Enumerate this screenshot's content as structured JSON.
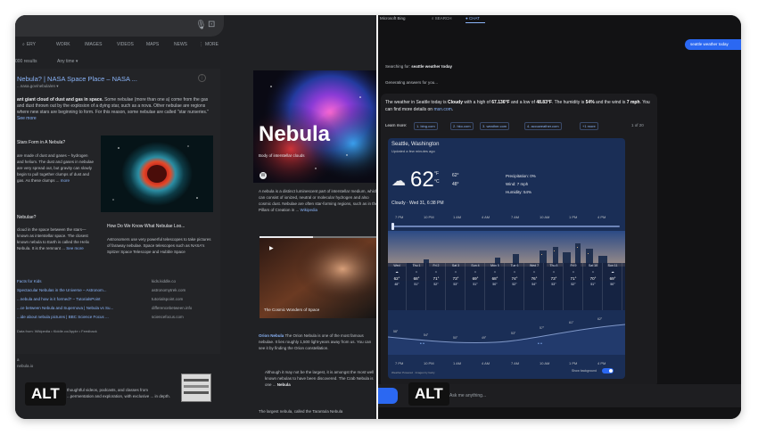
{
  "left": {
    "search": {
      "mic_icon": "microphone-icon",
      "camera_icon": "camera-icon"
    },
    "tabs": [
      "ERY",
      "WORK",
      "IMAGES",
      "VIDEOS",
      "MAPS",
      "NEWS",
      "MORE"
    ],
    "results_count": "000 results",
    "any_time": "Any time ▾",
    "result": {
      "title": "Nebula? | NASA Space Place – NASA ...",
      "url": "...nasa.gov/nebula/en ▾",
      "snippet_bold": "ant giant cloud of dust and gas in space.",
      "snippet": " Some nebulae (more than one a) come from the gas and dust thrown out by the explosion of a dying star, such as a nova. Other nebulae are regions where new stars are beginning to form. For this reason, some nebulae are called \"star nurseries.\"",
      "see_more": "See more"
    },
    "q1": "Stars Form in A Nebula?",
    "q1_text": "are made of dust and gases – hydrogen and helium. The dust and gases in nebulae are very spread out, but gravity can slowly begin to pull together clumps of dust and gas. As these clumps ...",
    "q1_more": "more",
    "q2": "Nebulae?",
    "q2_text": "cloud in the space between the stars—known as interstellar space. The closest known nebula to Earth is called the Helix Nebula. It is the remnant ...",
    "q2_more": "See more",
    "helix_question": "How Do We Know What Nebulae Loo...",
    "helix_text": "Astronomers use very powerful telescopes to take pictures of faraway nebulae. Space telescopes such as NASA's Spitzer Space Telescope and Hubble Space",
    "links": [
      {
        "title": "Facts for Kids",
        "domain": "kids.kiddle.co"
      },
      {
        "title": "Spectacular Nebulas in the Universe – Astronom...",
        "domain": "astronomytrek.com"
      },
      {
        "title": "...nebula and how is it formed? – TutorialsPoint",
        "domain": "tutorialspoint.com"
      },
      {
        "title": "...ce between Nebula and Supernova | Nebula vs Su...",
        "domain": "differencebetween.info"
      },
      {
        "title": "...ide about nebula pictures | BBC Science Focus ...",
        "domain": "sciencefocus.com"
      }
    ],
    "links_source": "Data from: Wikipedia • Kiddle.co/Apple • Feedback",
    "page_lines": [
      "a",
      "nebula.io"
    ],
    "bottom_text": "thoughtful videos, podcasts, and classes from ...permentation and exploration, with exclusive ... in depth.",
    "alt_label": "ALT"
  },
  "kp": {
    "title": "Nebula",
    "subtitle": "Body of interstellar clouds",
    "wiki_icon": "W",
    "description": "A nebula is a distinct luminescent part of interstellar medium, which can consist of ionized, neutral or molecular hydrogen and also cosmic dust. Nebulae are often star-forming regions, such as in the Pillars of Creation in ...",
    "wiki_link": "Wikipedia",
    "video_caption": "The Cosmic Wonders of Space",
    "orion_title": "Orion Nebula",
    "orion_text": "The Orion Nebula is one of the most famous nebulae. It lies roughly 1,500 light-years away from us. You can see it by finding the Orion constellation.",
    "quote_text": "Although it may not be the largest, it is amongst the most well known nebulas to have been discovered. The Crab Nebula is one ...",
    "quote_highlight": "Nebula",
    "tarantula": "The largest nebula, called the Tarantula Nebula"
  },
  "right": {
    "brand": "Microsoft Bing",
    "search_tab": "SEARCH",
    "chat_tab": "CHAT",
    "user_message": "seattle weather today",
    "searching_label": "Searching for:",
    "searching_query": "seattle weather today",
    "generating": "Generating answers for you...",
    "answer": {
      "text_1": "The weather in Seattle today is ",
      "cond": "Cloudy",
      "text_2": " with a high of ",
      "high": "67.136°F",
      "text_3": " and a low of ",
      "low": "48.83°F",
      "text_4": ". The humidity is ",
      "hum": "54%",
      "text_5": " and the wind is ",
      "wind": "7 mph",
      "text_6": ". You can find more details on ",
      "link": "msn.com",
      "text_7": "."
    },
    "learn_more": "Learn more:",
    "chips": [
      "1. bing.com",
      "2. hko.com",
      "3. weather.com",
      "4. accuweather.com",
      "+1 more"
    ],
    "count": "1 of 20",
    "weather": {
      "location": "Seattle, Washington",
      "updated": "Updated a few minutes ago",
      "icon": "cloud-icon",
      "temp": "62",
      "units": [
        "°F",
        "°C"
      ],
      "hi": "62°",
      "lo": "48°",
      "stats": [
        "Precipitation: 0%",
        "Wind: 7 mph",
        "Humidity: 54%"
      ],
      "condition": "Cloudy · Wed 31, 6:38 PM",
      "hours": [
        "7 PM",
        "10 PM",
        "1 AM",
        "4 AM",
        "7 AM",
        "10 AM",
        "1 PM",
        "4 PM"
      ],
      "forecast": [
        {
          "day": "Wed",
          "hi": "62°",
          "lo": "48°"
        },
        {
          "day": "Thu 1",
          "hi": "68°",
          "lo": "51°"
        },
        {
          "day": "Fri 2",
          "hi": "71°",
          "lo": "52°"
        },
        {
          "day": "Sat 3",
          "hi": "73°",
          "lo": "53°"
        },
        {
          "day": "Sun 4",
          "hi": "69°",
          "lo": "51°"
        },
        {
          "day": "Mon 5",
          "hi": "68°",
          "lo": "50°"
        },
        {
          "day": "Tue 6",
          "hi": "74°",
          "lo": "52°"
        },
        {
          "day": "Wed 7",
          "hi": "76°",
          "lo": "54°"
        },
        {
          "day": "Thu 8",
          "hi": "73°",
          "lo": "53°"
        },
        {
          "day": "Fri 9",
          "hi": "71°",
          "lo": "52°"
        },
        {
          "day": "Sat 10",
          "hi": "70°",
          "lo": "51°"
        },
        {
          "day": "Sun 11",
          "hi": "69°",
          "lo": "50°"
        }
      ],
      "graph_temps": [
        "58°",
        "54°",
        "50°",
        "49°",
        "53°",
        "57°",
        "61°",
        "62°"
      ],
      "foot_hours": [
        "7 PM",
        "10 PM",
        "1 AM",
        "4 AM",
        "7 AM",
        "10 AM",
        "1 PM",
        "4 PM"
      ],
      "footer_left": "Weather Powered · Images by Getty",
      "show_background": "Show background"
    },
    "ask_placeholder": "Ask me anything...",
    "alt_label": "ALT"
  },
  "colors": {
    "accent": "#2b68f2",
    "link": "#8ab4f8",
    "left_bg": "#202124",
    "right_bg": "#121214"
  }
}
